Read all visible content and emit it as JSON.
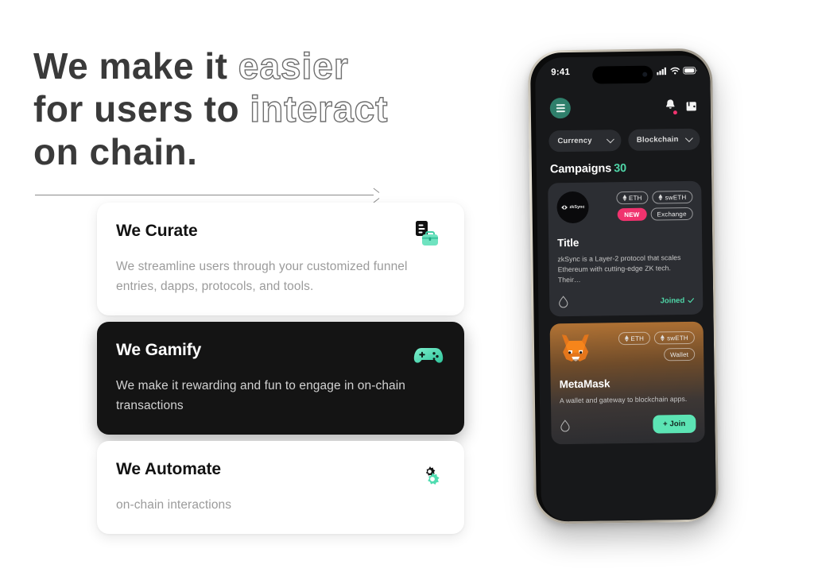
{
  "hero": {
    "line1_plain": "We make it ",
    "line1_outline": "easier",
    "line2_plain": "for users to ",
    "line2_outline": "interact",
    "line3_plain": "on chain."
  },
  "feature_cards": [
    {
      "title": "We Curate",
      "body": "We streamline users through your customized funnel entries, dapps, protocols, and tools.",
      "icon": "briefcase-document-icon",
      "theme": "light"
    },
    {
      "title": "We Gamify",
      "body": "We make it rewarding and fun to engage in on-chain transactions",
      "icon": "gamepad-icon",
      "theme": "dark"
    },
    {
      "title": "We Automate",
      "body": "on-chain interactions",
      "icon": "gears-icon",
      "theme": "light"
    }
  ],
  "phone": {
    "status_bar": {
      "time": "9:41",
      "icons": [
        "cellular-signal-icon",
        "wifi-icon",
        "battery-icon"
      ]
    },
    "app_bar": {
      "menu_icon": "hamburger-menu-icon",
      "bell_icon": "notification-bell-icon",
      "wallet_icon": "wallet-icon",
      "has_notification_badge": true
    },
    "filters": [
      {
        "label": "Currency",
        "icon": "chevron-down-icon"
      },
      {
        "label": "Blockchain",
        "icon": "chevron-down-icon"
      }
    ],
    "section": {
      "title": "Campaigns",
      "count": "30"
    },
    "campaigns": [
      {
        "avatar_label": "zkSync",
        "avatar_type": "zksync-logo",
        "tags": [
          "ETH",
          "swETH",
          "NEW",
          "Exchange"
        ],
        "badge_tag": "NEW",
        "category_tag": "Exchange",
        "title": "Title",
        "description": "zkSync is a Layer-2 protocol that scales Ethereum with cutting-edge ZK tech. Their…",
        "drop_icon": "droplet-icon",
        "action_label": "Joined",
        "action_type": "joined",
        "check_icon": "check-icon"
      },
      {
        "avatar_label": "MetaMask",
        "avatar_type": "metamask-fox-logo",
        "tags": [
          "ETH",
          "swETH",
          "Wallet"
        ],
        "category_tag": "Wallet",
        "title": "MetaMask",
        "description": "A wallet and gateway to blockchain apps.",
        "drop_icon": "droplet-icon",
        "action_label": "+ Join",
        "action_type": "join"
      }
    ]
  },
  "colors": {
    "accent_teal": "#5ce4b4",
    "accent_green": "#4fd6a8",
    "menu_green": "#2f7f6b",
    "badge_pink": "#f0336e",
    "dark_card": "#141414",
    "phone_screen": "#17181a"
  }
}
